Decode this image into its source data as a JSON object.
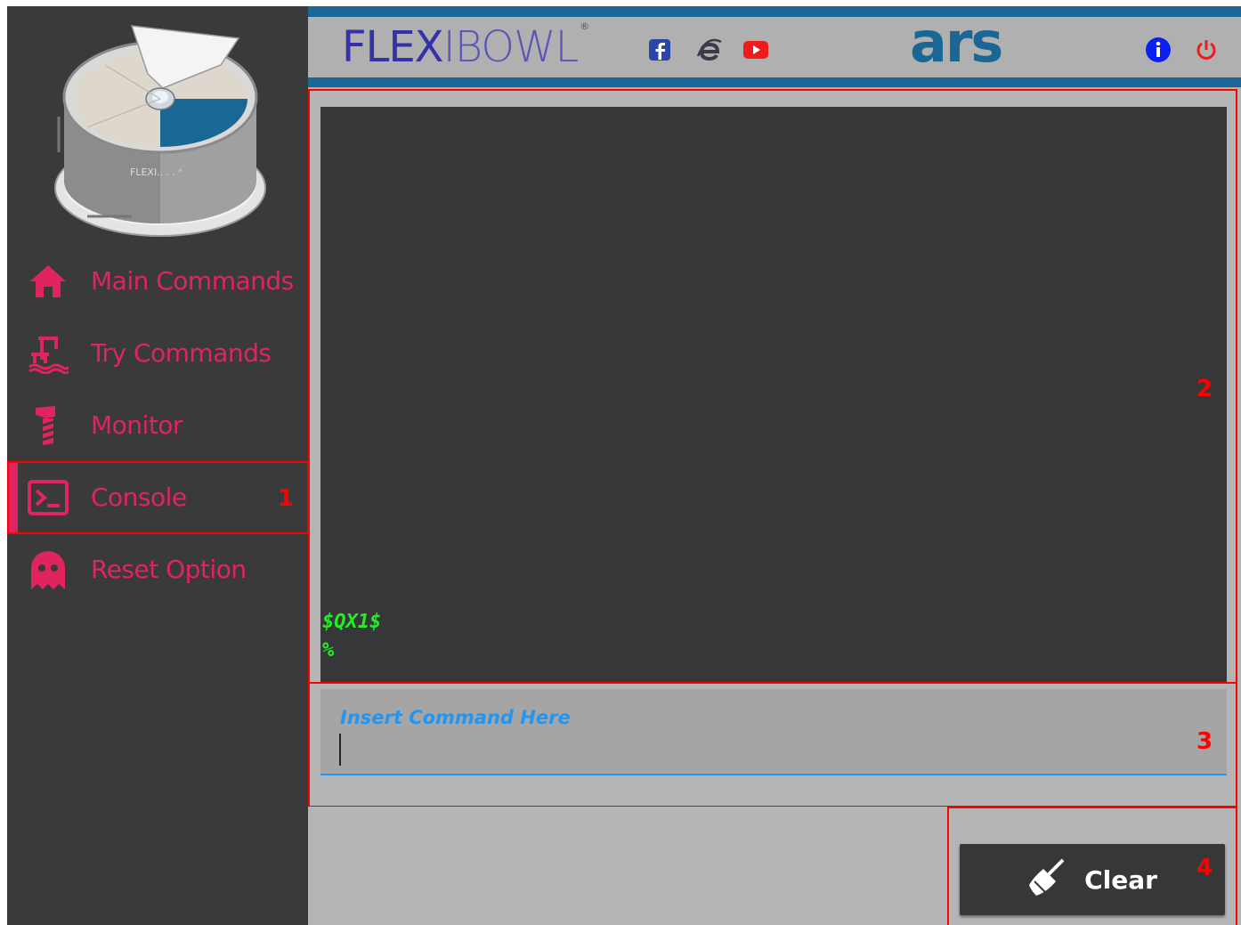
{
  "sidebar": {
    "items": [
      {
        "label": "Main Commands",
        "icon": "home-icon"
      },
      {
        "label": "Try Commands",
        "icon": "try-commands-icon"
      },
      {
        "label": "Monitor",
        "icon": "monitor-icon"
      },
      {
        "label": "Console",
        "icon": "terminal-icon",
        "active": true,
        "annotation": "1"
      },
      {
        "label": "Reset Option",
        "icon": "ghost-icon"
      }
    ],
    "accent_color": "#e0245e"
  },
  "header": {
    "brand": {
      "bold": "FLEX",
      "thin": "IBOWL",
      "mark": "®"
    },
    "social_icons": [
      "facebook-icon",
      "internet-explorer-icon",
      "youtube-icon"
    ],
    "logo_text": "ars",
    "right_icons": [
      "info-icon",
      "power-icon"
    ],
    "bar_color": "#1a6796"
  },
  "console": {
    "lines": [
      "$QX1$",
      "%"
    ],
    "text_color": "#22ee22",
    "annotation": "2"
  },
  "command_input": {
    "label": "Insert Command Here",
    "value": "",
    "annotation": "3"
  },
  "actions": {
    "clear_label": "Clear",
    "clear_icon": "broom-icon",
    "annotation": "4"
  }
}
